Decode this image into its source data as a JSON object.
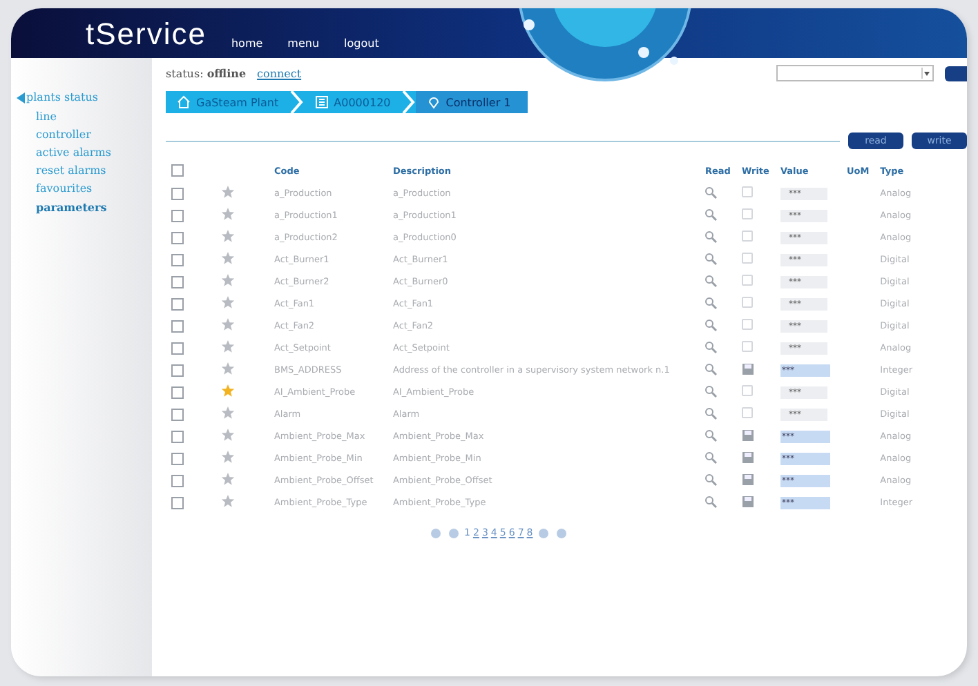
{
  "header": {
    "logo": "tService",
    "nav": [
      "home",
      "menu",
      "logout"
    ]
  },
  "sidebar": {
    "title": "plants status",
    "items": [
      {
        "label": "line",
        "selected": false
      },
      {
        "label": "controller",
        "selected": false
      },
      {
        "label": "active alarms",
        "selected": false
      },
      {
        "label": "reset alarms",
        "selected": false
      },
      {
        "label": "favourites",
        "selected": false
      },
      {
        "label": "parameters",
        "selected": true
      }
    ]
  },
  "status": {
    "label": "status:",
    "value": "offline",
    "link": "connect"
  },
  "breadcrumb": [
    {
      "label": "GaSteam Plant",
      "kind": "plant",
      "selected": false
    },
    {
      "label": "A0000120",
      "kind": "device",
      "selected": false
    },
    {
      "label": "Controller 1",
      "kind": "controller",
      "selected": true
    }
  ],
  "actions": [
    "read",
    "write"
  ],
  "table": {
    "columns": [
      "Code",
      "Description",
      "Read",
      "Write",
      "Value",
      "UoM",
      "Type"
    ],
    "all_selected": false,
    "rows": [
      {
        "selected": false,
        "code": "a_Production",
        "description": "a_Production",
        "favourite": false,
        "writable": false,
        "value": "***",
        "type": "Analog"
      },
      {
        "selected": false,
        "code": "a_Production1",
        "description": "a_Production1",
        "favourite": false,
        "writable": false,
        "value": "***",
        "type": "Analog"
      },
      {
        "selected": false,
        "code": "a_Production2",
        "description": "a_Production0",
        "favourite": false,
        "writable": false,
        "value": "***",
        "type": "Analog"
      },
      {
        "selected": false,
        "code": "Act_Burner1",
        "description": "Act_Burner1",
        "favourite": false,
        "writable": false,
        "value": "***",
        "type": "Digital"
      },
      {
        "selected": false,
        "code": "Act_Burner2",
        "description": "Act_Burner0",
        "favourite": false,
        "writable": false,
        "value": "***",
        "type": "Digital"
      },
      {
        "selected": false,
        "code": "Act_Fan1",
        "description": "Act_Fan1",
        "favourite": false,
        "writable": false,
        "value": "***",
        "type": "Digital"
      },
      {
        "selected": false,
        "code": "Act_Fan2",
        "description": "Act_Fan2",
        "favourite": false,
        "writable": false,
        "value": "***",
        "type": "Digital"
      },
      {
        "selected": false,
        "code": "Act_Setpoint",
        "description": "Act_Setpoint",
        "favourite": false,
        "writable": false,
        "value": "***",
        "type": "Analog"
      },
      {
        "selected": false,
        "code": "BMS_ADDRESS",
        "description": "Address of the controller in a supervisory system network n.1",
        "favourite": false,
        "writable": true,
        "value": "***",
        "type": "Integer"
      },
      {
        "selected": false,
        "code": "AI_Ambient_Probe",
        "description": "AI_Ambient_Probe",
        "favourite": true,
        "writable": false,
        "value": "***",
        "type": "Digital"
      },
      {
        "selected": false,
        "code": "Alarm",
        "description": "Alarm",
        "favourite": false,
        "writable": false,
        "value": "***",
        "type": "Digital"
      },
      {
        "selected": false,
        "code": "Ambient_Probe_Max",
        "description": "Ambient_Probe_Max",
        "favourite": false,
        "writable": true,
        "value": "***",
        "type": "Analog"
      },
      {
        "selected": false,
        "code": "Ambient_Probe_Min",
        "description": "Ambient_Probe_Min",
        "favourite": false,
        "writable": true,
        "value": "***",
        "type": "Analog"
      },
      {
        "selected": false,
        "code": "Ambient_Probe_Offset",
        "description": "Ambient_Probe_Offset",
        "favourite": false,
        "writable": true,
        "value": "***",
        "type": "Analog"
      },
      {
        "selected": false,
        "code": "Ambient_Probe_Type",
        "description": "Ambient_Probe_Type",
        "favourite": false,
        "writable": true,
        "value": "***",
        "type": "Integer"
      }
    ]
  },
  "pagination": {
    "pages": [
      {
        "label": "1",
        "selected": true
      },
      {
        "label": "2",
        "selected": false
      },
      {
        "label": "3",
        "selected": false
      },
      {
        "label": "4",
        "selected": false
      },
      {
        "label": "5",
        "selected": false
      },
      {
        "label": "6",
        "selected": false
      },
      {
        "label": "7",
        "selected": false
      },
      {
        "label": "8",
        "selected": false
      }
    ]
  }
}
